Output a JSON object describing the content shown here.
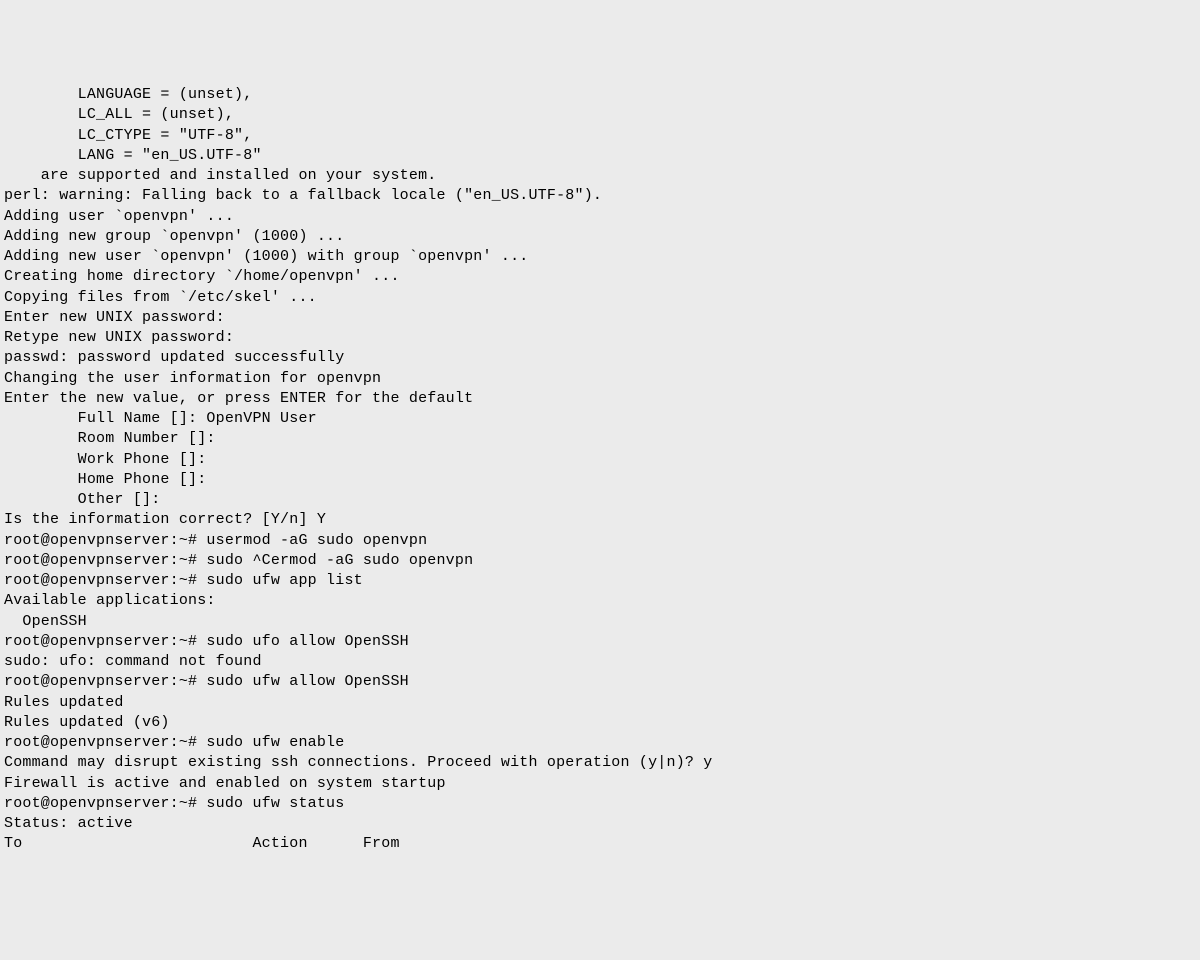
{
  "terminal": {
    "lines": [
      "        LANGUAGE = (unset),",
      "        LC_ALL = (unset),",
      "        LC_CTYPE = \"UTF-8\",",
      "        LANG = \"en_US.UTF-8\"",
      "    are supported and installed on your system.",
      "perl: warning: Falling back to a fallback locale (\"en_US.UTF-8\").",
      "Adding user `openvpn' ...",
      "Adding new group `openvpn' (1000) ...",
      "Adding new user `openvpn' (1000) with group `openvpn' ...",
      "Creating home directory `/home/openvpn' ...",
      "Copying files from `/etc/skel' ...",
      "Enter new UNIX password:",
      "Retype new UNIX password:",
      "passwd: password updated successfully",
      "Changing the user information for openvpn",
      "Enter the new value, or press ENTER for the default",
      "        Full Name []: OpenVPN User",
      "        Room Number []:",
      "        Work Phone []:",
      "        Home Phone []:",
      "        Other []:",
      "Is the information correct? [Y/n] Y",
      "root@openvpnserver:~# usermod -aG sudo openvpn",
      "root@openvpnserver:~# sudo ^Cermod -aG sudo openvpn",
      "root@openvpnserver:~# sudo ufw app list",
      "Available applications:",
      "  OpenSSH",
      "root@openvpnserver:~# sudo ufo allow OpenSSH",
      "sudo: ufo: command not found",
      "root@openvpnserver:~# sudo ufw allow OpenSSH",
      "Rules updated",
      "Rules updated (v6)",
      "root@openvpnserver:~# sudo ufw enable",
      "Command may disrupt existing ssh connections. Proceed with operation (y|n)? y",
      "Firewall is active and enabled on system startup",
      "root@openvpnserver:~# sudo ufw status",
      "Status: active",
      "",
      "To                         Action      From"
    ]
  }
}
